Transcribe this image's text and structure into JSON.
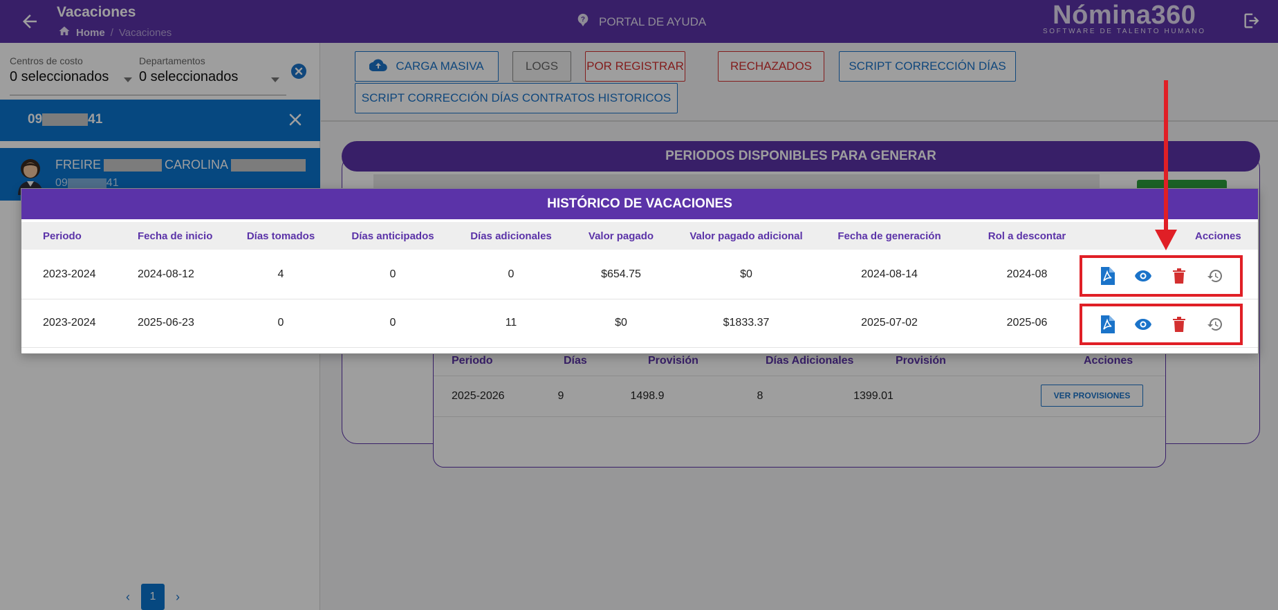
{
  "header": {
    "title": "Vacaciones",
    "breadcrumb_home": "Home",
    "breadcrumb_separator": "/",
    "breadcrumb_current": "Vacaciones",
    "help_label": "PORTAL DE AYUDA",
    "logo_name": "Nómina360",
    "logo_tagline": "SOFTWARE DE TALENTO HUMANO",
    "bg_color": "#5b33a8"
  },
  "sidebar": {
    "filters": {
      "cost_centers_label": "Centros de costo",
      "cost_centers_value": "0 seleccionados",
      "departments_label": "Departamentos",
      "departments_value": "0 seleccionados"
    },
    "search_chip": {
      "prefix": "09",
      "suffix": "41"
    },
    "employee": {
      "first_name": "FREIRE",
      "second_name": "CAROLINA",
      "id_prefix": "09",
      "id_suffix": "41"
    },
    "pagination": {
      "current_page": "1"
    }
  },
  "toolbar": {
    "carga_masiva": "CARGA MASIVA",
    "logs": "LOGS",
    "por_registrar": "POR REGISTRAR",
    "rechazados": "RECHAZADOS",
    "script_dias": "SCRIPT CORRECCIÓN DÍAS",
    "script_historicos": "SCRIPT CORRECCIÓN DÍAS CONTRATOS HISTORICOS"
  },
  "periods_panel": {
    "title": "PERIODOS DISPONIBLES PARA GENERAR"
  },
  "provisions_table": {
    "headers": [
      "Periodo",
      "Días",
      "Provisión",
      "Días Adicionales",
      "Provisión",
      "Acciones"
    ],
    "rows": [
      {
        "periodo": "2025-2026",
        "dias": "9",
        "provision": "1498.9",
        "dias_adicionales": "8",
        "provision_adicional": "1399.01",
        "action_label": "VER PROVISIONES"
      }
    ]
  },
  "history_modal": {
    "title": "HISTÓRICO DE VACACIONES",
    "headers": [
      "Periodo",
      "Fecha de inicio",
      "Días tomados",
      "Días anticipados",
      "Días adicionales",
      "Valor pagado",
      "Valor pagado adicional",
      "Fecha de generación",
      "Rol a descontar",
      "Acciones"
    ],
    "rows": [
      {
        "periodo": "2023-2024",
        "fecha_inicio": "2024-08-12",
        "dias_tomados": "4",
        "dias_anticipados": "0",
        "dias_adicionales": "0",
        "valor_pagado": "$654.75",
        "valor_adicional": "$0",
        "fecha_generacion": "2024-08-14",
        "rol_descontar": "2024-08"
      },
      {
        "periodo": "2023-2024",
        "fecha_inicio": "2025-06-23",
        "dias_tomados": "0",
        "dias_anticipados": "0",
        "dias_adicionales": "11",
        "valor_pagado": "$0",
        "valor_adicional": "$1833.37",
        "fecha_generacion": "2025-07-02",
        "rol_descontar": "2025-06"
      }
    ],
    "row_actions": [
      "pdf-icon",
      "eye-icon",
      "trash-icon",
      "history-icon"
    ]
  },
  "annotation_color": "#e01f26"
}
